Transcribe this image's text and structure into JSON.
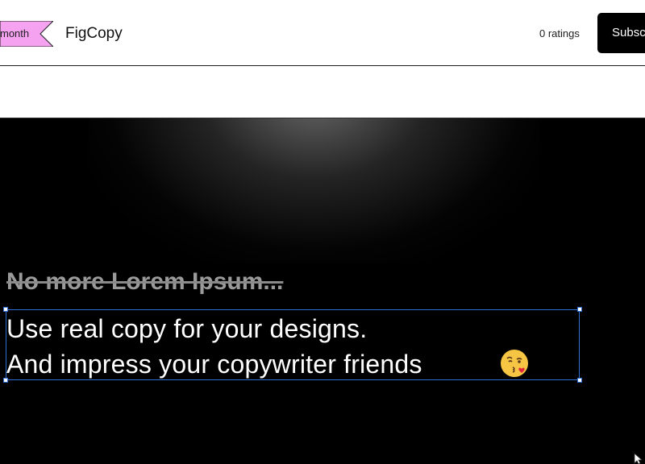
{
  "header": {
    "ribbon_label": "month",
    "app_title": "FigCopy",
    "ratings": "0 ratings",
    "subscribe_label": "Subscribe"
  },
  "hero": {
    "struck_text": "No more Lorem Ipsum...",
    "line1": "Use real copy for your designs.",
    "line2": "And impress your copywriter friends"
  },
  "colors": {
    "ribbon": "#f5a3f0",
    "selection": "#2f6fd6",
    "hero_bg": "#000000",
    "button": "#000000"
  },
  "icons": {
    "emoji": "kissing-face-emoji"
  }
}
